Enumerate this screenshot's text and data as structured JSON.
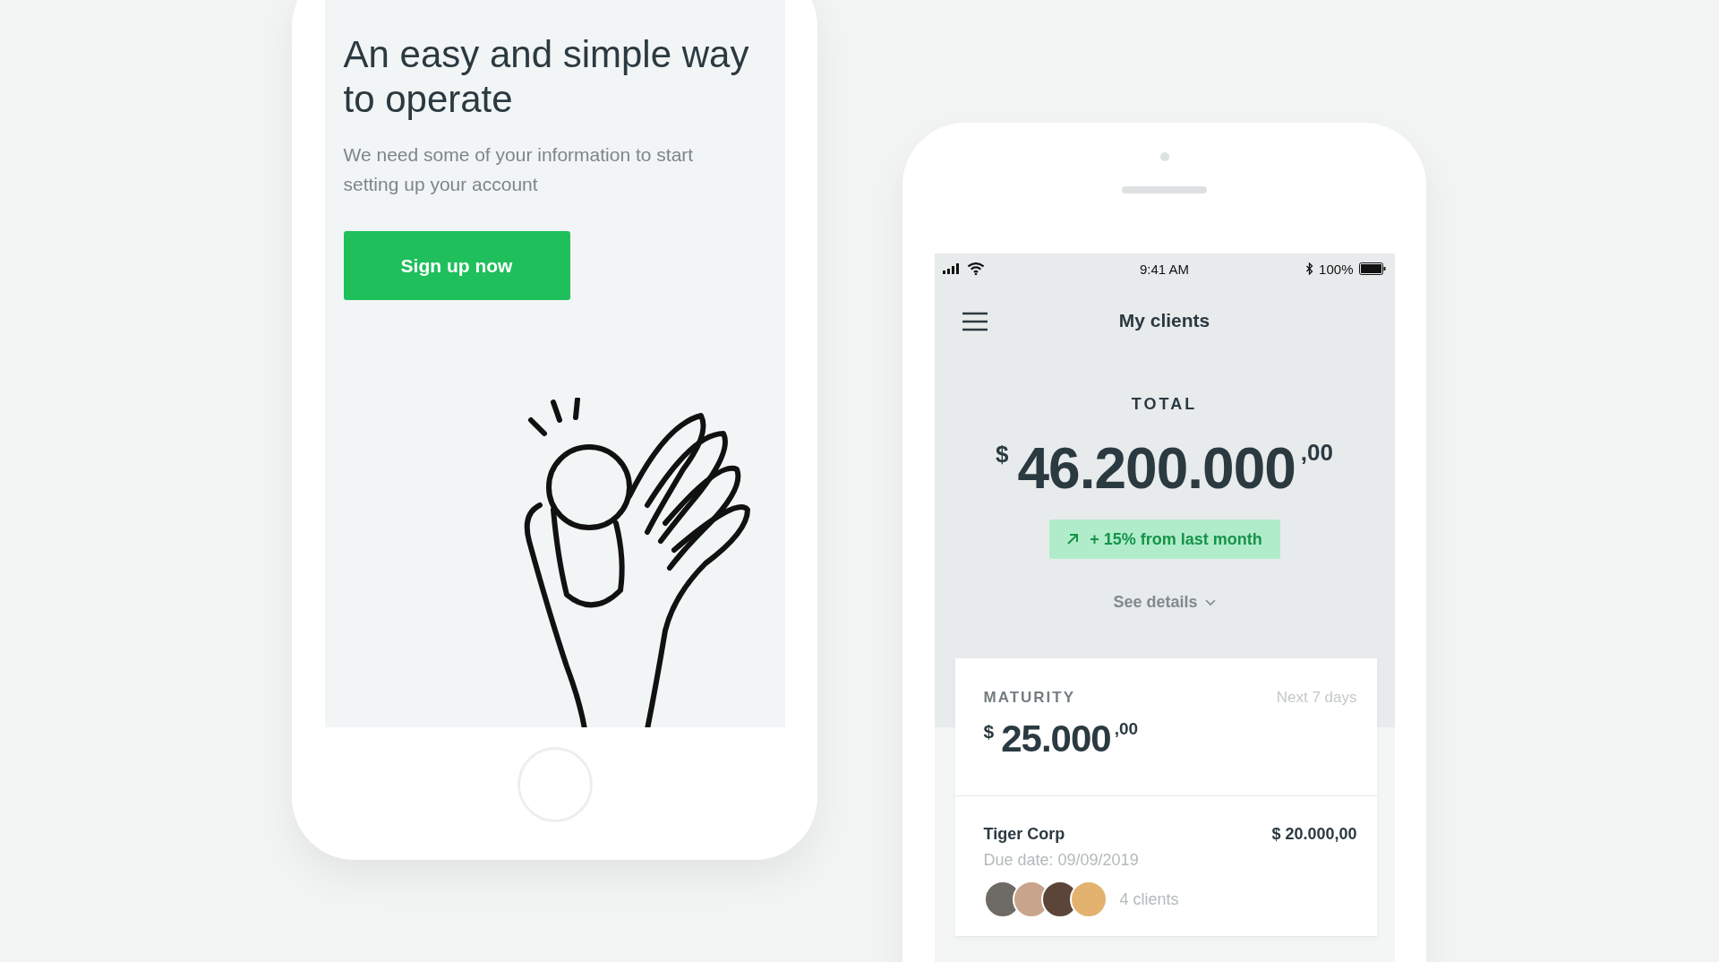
{
  "signup_screen": {
    "heading": "An easy and simple way to operate",
    "subtitle": "We need some of your information to start setting up your account",
    "button": "Sign up now"
  },
  "status_bar": {
    "time": "9:41 AM",
    "battery": "100%"
  },
  "header": {
    "title": "My clients"
  },
  "total": {
    "label": "TOTAL",
    "currency": "$",
    "amount": "46.200.000",
    "cents": ",00",
    "change": "+ 15% from last month",
    "details_link": "See details"
  },
  "maturity": {
    "label": "MATURITY",
    "period": "Next 7 days",
    "currency": "$",
    "amount": "25.000",
    "cents": ",00"
  },
  "clients": [
    {
      "name": "Tiger Corp",
      "amount": "$ 20.000,00",
      "due_date": "Due date: 09/09/2019",
      "clients_count": "4 clients"
    }
  ]
}
